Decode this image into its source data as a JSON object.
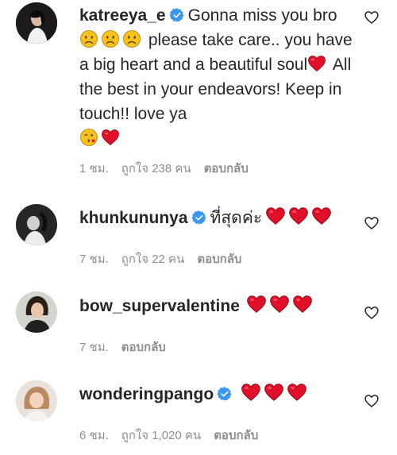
{
  "comments": [
    {
      "username": "katreeya_e",
      "verified": true,
      "text_1": "Gonna miss you bro",
      "text_2": "please take care.. you have a big heart and a beautiful soul",
      "text_3": "All the best in your endeavors! Keep in touch!! love ya",
      "time": "1 ชม.",
      "likes": "ถูกใจ 238 คน",
      "reply": "ตอบกลับ"
    },
    {
      "username": "khunkununya",
      "verified": true,
      "text_1": "ที่สุดค่ะ",
      "time": "7 ชม.",
      "likes": "ถูกใจ 22 คน",
      "reply": "ตอบกลับ"
    },
    {
      "username": "bow_supervalentine",
      "verified": false,
      "time": "7 ชม.",
      "reply": "ตอบกลับ"
    },
    {
      "username": "wonderingpango",
      "verified": true,
      "time": "6 ชม.",
      "likes": "ถูกใจ 1,020 คน",
      "reply": "ตอบกลับ"
    }
  ],
  "colors": {
    "verified": "#3897f0",
    "heart": "#e0102a",
    "meta": "#8e8e8e"
  },
  "icons": [
    "verified-badge-icon",
    "red-heart-emoji",
    "sad-face-emoji",
    "kiss-face-emoji",
    "like-heart-icon"
  ]
}
